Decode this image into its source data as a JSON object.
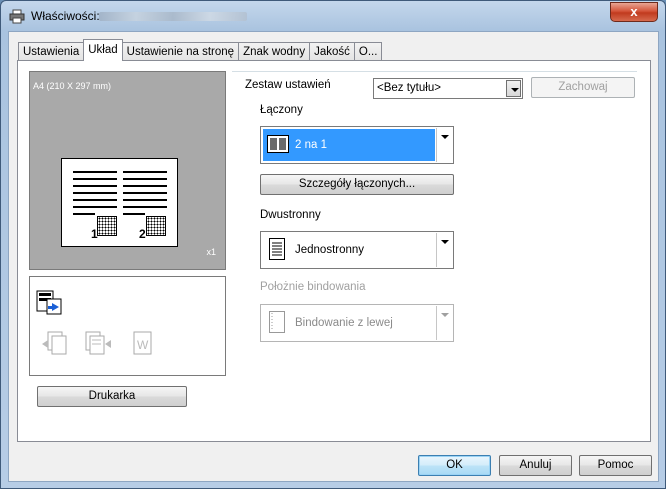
{
  "window": {
    "title": "Właściwości:",
    "close_glyph": "x"
  },
  "tabs": [
    {
      "label": "Ustawienia"
    },
    {
      "label": "Układ"
    },
    {
      "label": "Ustawienie na stronę"
    },
    {
      "label": "Znak wodny"
    },
    {
      "label": "Jakość"
    },
    {
      "label": "O..."
    }
  ],
  "preview": {
    "paper_label": "A4  (210 X 297 mm)",
    "scale": "x1",
    "page_numbers": [
      "1",
      "2"
    ]
  },
  "printer_button": "Drukarka",
  "preset": {
    "label": "Zestaw ustawień",
    "value": "<Bez tytułu>",
    "save_button": "Zachowaj"
  },
  "combine": {
    "label": "Łączony",
    "value": "2 na 1",
    "details_button": "Szczegóły łączonych..."
  },
  "duplex": {
    "label": "Dwustronny",
    "value": "Jednostronny"
  },
  "binding": {
    "label": "Położnie bindowania",
    "value": "Bindowanie z lewej"
  },
  "footer": {
    "ok": "OK",
    "cancel": "Anuluj",
    "help": "Pomoc"
  },
  "colors": {
    "selection": "#3399ff",
    "close_button": "#c13a1e",
    "preview_bg": "#a9a9a9"
  }
}
